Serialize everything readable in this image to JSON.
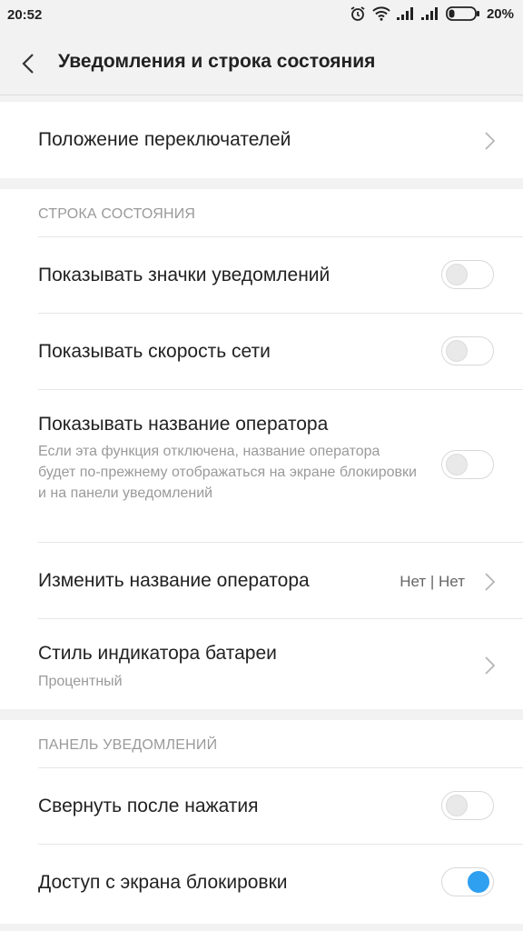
{
  "status_bar": {
    "time": "20:52",
    "battery_percent": "20%",
    "icons": [
      "alarm-icon",
      "wifi-icon",
      "signal-icon",
      "signal-icon",
      "battery-icon"
    ]
  },
  "header": {
    "title": "Уведомления и строка состояния",
    "back_icon": "chevron-left-icon"
  },
  "top_item": {
    "label": "Положение переключателей"
  },
  "status_section": {
    "title": "СТРОКА СОСТОЯНИЯ",
    "items": [
      {
        "label": "Показывать значки уведомлений",
        "enabled": false
      },
      {
        "label": "Показывать скорость сети",
        "enabled": false
      },
      {
        "label": "Показывать название оператора",
        "description": "Если эта функция отключена, название оператора будет по-прежнему отображаться на экране блокировки и на панели уведомлений",
        "enabled": false
      }
    ],
    "carrier_name": {
      "label": "Изменить название оператора",
      "value": "Нет | Нет"
    },
    "battery_style": {
      "label": "Стиль индикатора батареи",
      "value": "Процентный"
    }
  },
  "notification_section": {
    "title": "ПАНЕЛЬ УВЕДОМЛЕНИЙ",
    "items": [
      {
        "label": "Свернуть после нажатия",
        "enabled": false
      },
      {
        "label": "Доступ с экрана блокировки",
        "enabled": true
      }
    ]
  },
  "colors": {
    "accent": "#2f9ff0",
    "background": "#f2f2f2",
    "card": "#ffffff"
  }
}
